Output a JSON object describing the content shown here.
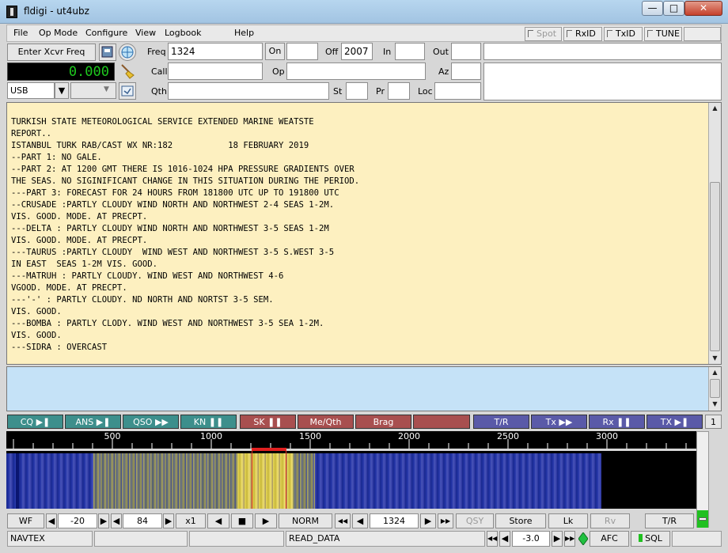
{
  "window": {
    "title": "fldigi - ut4ubz"
  },
  "menu": [
    "File",
    "Op Mode",
    "Configure",
    "View",
    "Logbook",
    "Help"
  ],
  "menu_toggles": [
    "Spot",
    "RxID",
    "TxID",
    "TUNE"
  ],
  "xcvr": {
    "label": "Enter Xcvr Freq",
    "frequency": "0.000",
    "mode": "USB"
  },
  "qso": {
    "freq_label": "Freq",
    "freq_value": "1324",
    "on_label": "On",
    "off_label": "Off",
    "off_value": "2007",
    "in_label": "In",
    "out_label": "Out",
    "call_label": "Call",
    "op_label": "Op",
    "az_label": "Az",
    "qth_label": "Qth",
    "st_label": "St",
    "pr_label": "Pr",
    "loc_label": "Loc"
  },
  "rx_lines": [
    "TURKISH STATE METEOROLOGICAL SERVICE EXTENDED MARINE WEATSTE",
    "REPORT..",
    "ISTANBUL TURK RAB/CAST WX NR:182           18 FEBRUARY 2019",
    "--PART 1: NO GALE.",
    "--PART 2: AT 1200 GMT THERE IS 1016-1024 HPA PRESSURE GRADIENTS OVER",
    "THE SEAS. NO SIGINIFICANT CHANGE IN THIS SITUATION DURING THE PERIOD.",
    "---PART 3: FORECAST FOR 24 HOURS FROM 181800 UTC UP TO 191800 UTC",
    "--CRUSADE :PARTLY CLOUDY WIND NORTH AND NORTHWEST 2-4 SEAS 1-2M.",
    "VIS. GOOD. MODE. AT PRECPT.",
    "---DELTA : PARTLY CLOUDY WIND NORTH AND NORTHWEST 3-5 SEAS 1-2M",
    "VIS. GOOD. MODE. AT PRECPT.",
    "---TAURUS :PARTLY CLOUDY  WIND WEST AND NORTHWEST 3-5 S.WEST 3-5",
    "IN EAST  SEAS 1-2M VIS. GOOD.",
    "---MATRUH : PARTLY CLOUDY. WIND WEST AND NORTHWEST 4-6",
    "VGOOD. MODE. AT PRECPT.",
    "---'-' : PARTLY CLOUDY. ND NORTH AND NORTST 3-5 SEM.",
    "VIS. GOOD.",
    "---BOMBA : PARTLY CLODY. WIND WEST AND NORTHWEST 3-5 SEA 1-2M.",
    "VIS. GOOD.",
    "---SIDRA : OVERCAST"
  ],
  "macros": {
    "cq": "CQ",
    "ans": "ANS",
    "qso": "QSO",
    "kn": "KN",
    "sk": "SK",
    "meqth": "Me/Qth",
    "brag": "Brag",
    "tr": "T/R",
    "tx": "Tx",
    "rx": "Rx",
    "tx2": "TX",
    "page": "1"
  },
  "scale_ticks": [
    "500",
    "1000",
    "1500",
    "2000",
    "2500",
    "3000"
  ],
  "controls": {
    "wf": "WF",
    "floor": "-20",
    "range": "84",
    "zoom": "x1",
    "norm": "NORM",
    "carrier": "1324",
    "qsy": "QSY",
    "store": "Store",
    "lk": "Lk",
    "rv": "Rv",
    "tr": "T/R"
  },
  "status": {
    "mode": "NAVTEX",
    "message": "READ_DATA",
    "s2n": "-3.0",
    "afc": "AFC",
    "sql": "SQL"
  }
}
